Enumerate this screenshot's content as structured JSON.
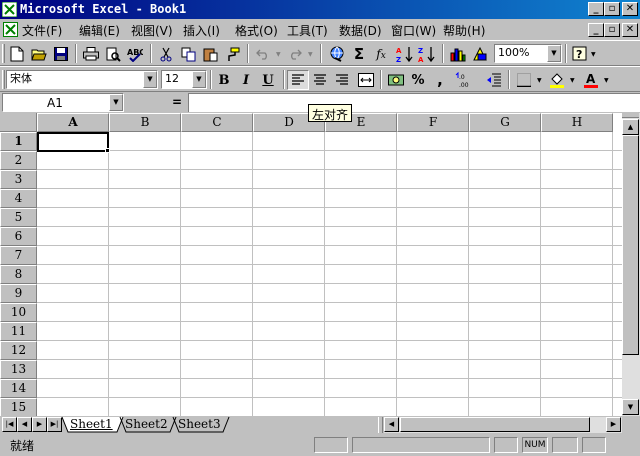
{
  "window": {
    "title": "Microsoft Excel - Book1",
    "min_glyph": "_",
    "max_glyph": "▫",
    "close_glyph": "✕"
  },
  "menu": {
    "items": [
      "文件(F)",
      "编辑(E)",
      "视图(V)",
      "插入(I)",
      "格式(O)",
      "工具(T)",
      "数据(D)",
      "窗口(W)",
      "帮助(H)"
    ]
  },
  "standard_toolbar": {
    "zoom": "100%",
    "icons": [
      "new-icon",
      "open-icon",
      "save-icon",
      "print-icon",
      "print-preview-icon",
      "spelling-icon",
      "cut-icon",
      "copy-icon",
      "paste-icon",
      "format-painter-icon",
      "undo-icon",
      "redo-icon",
      "hyperlink-icon",
      "autosum-icon",
      "function-icon",
      "sort-ascending-icon",
      "sort-descending-icon",
      "chart-wizard-icon",
      "drawing-icon",
      "help-icon"
    ]
  },
  "formatting_toolbar": {
    "font": "宋体",
    "size": "12",
    "bold": "B",
    "italic": "I",
    "underline": "U",
    "percent": "%",
    "comma": ","
  },
  "formula_bar": {
    "cell_ref": "A1",
    "equals": "=",
    "content": ""
  },
  "tooltip": {
    "text": "左对齐"
  },
  "sheet": {
    "columns": [
      "A",
      "B",
      "C",
      "D",
      "E",
      "F",
      "G",
      "H"
    ],
    "rows": [
      "1",
      "2",
      "3",
      "4",
      "5",
      "6",
      "7",
      "8",
      "9",
      "10",
      "11",
      "12",
      "13",
      "14",
      "15"
    ],
    "active_cell": "A1"
  },
  "tabs": [
    "Sheet1",
    "Sheet2",
    "Sheet3"
  ],
  "active_tab": "Sheet1",
  "status": {
    "text": "就绪",
    "num_indicator": "NUM"
  },
  "colors": {
    "title_bar": "#000080",
    "face": "#c0c0c0",
    "grid_line": "#c0c0c0",
    "tooltip_bg": "#ffffe1"
  }
}
